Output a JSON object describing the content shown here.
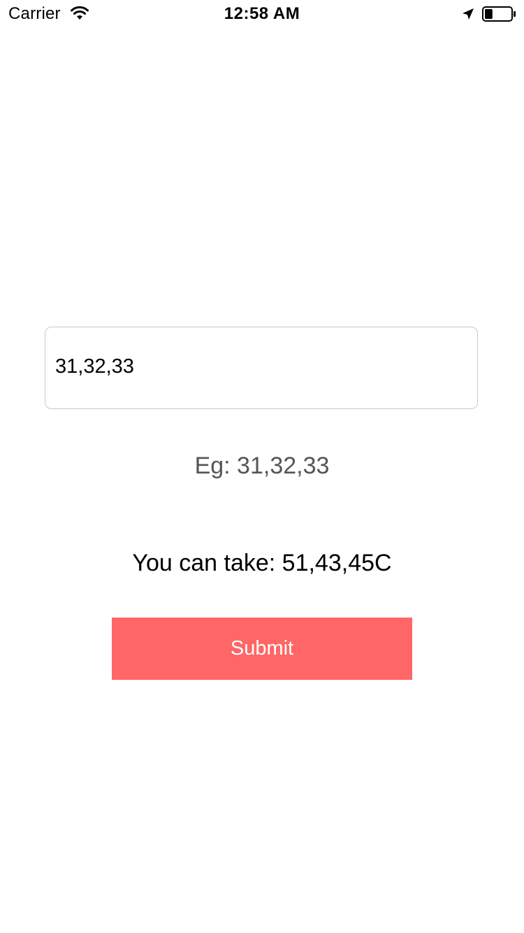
{
  "status_bar": {
    "carrier": "Carrier",
    "time": "12:58 AM",
    "icons": [
      "wifi-icon",
      "location-arrow-icon",
      "battery-icon"
    ],
    "battery_level": 0.3
  },
  "form": {
    "input_value": "31,32,33",
    "hint": "Eg: 31,32,33",
    "result": "You can take: 51,43,45C",
    "submit_label": "Submit"
  },
  "colors": {
    "submit_background": "#ff6666",
    "submit_text": "#ffffff",
    "hint_text": "#555555",
    "input_border": "#c8c8c8"
  }
}
